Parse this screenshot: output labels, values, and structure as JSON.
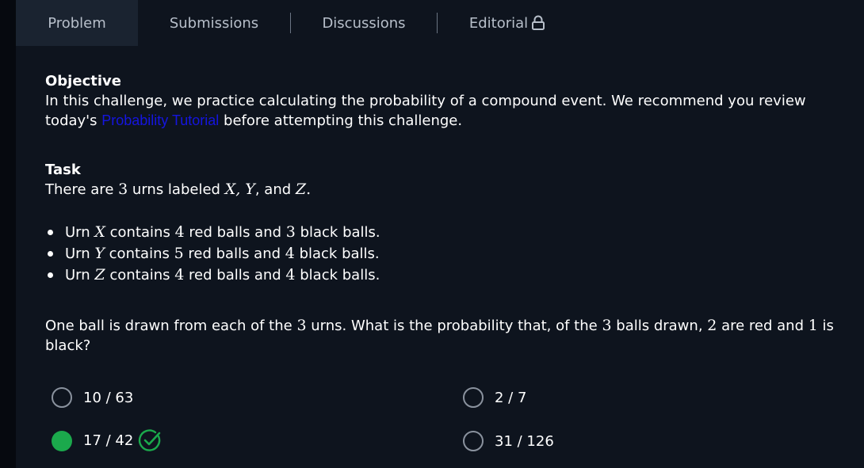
{
  "tabs": [
    {
      "label": "Problem"
    },
    {
      "label": "Submissions"
    },
    {
      "label": "Discussions"
    },
    {
      "label": "Editorial"
    }
  ],
  "objective": {
    "heading": "Objective",
    "text_before": "In this challenge, we practice calculating the probability of a compound event. We recommend you review today's ",
    "link": "Probability Tutorial",
    "text_after": " before attempting this challenge."
  },
  "task": {
    "heading": "Task",
    "intro": {
      "p1": "There are ",
      "n": "3",
      "p2": " urns labeled ",
      "labels": "X, Y",
      "p3": ", and ",
      "last": "Z",
      "p4": "."
    },
    "bullets": [
      {
        "pre": "Urn ",
        "urn": "X",
        "mid1": " contains ",
        "red": "4",
        "mid2": " red balls and ",
        "black": "3",
        "post": " black balls."
      },
      {
        "pre": "Urn ",
        "urn": "Y",
        "mid1": " contains ",
        "red": "5",
        "mid2": " red balls and ",
        "black": "4",
        "post": " black balls."
      },
      {
        "pre": "Urn ",
        "urn": "Z",
        "mid1": " contains ",
        "red": "4",
        "mid2": " red balls and ",
        "black": "4",
        "post": " black balls."
      }
    ]
  },
  "question": {
    "p1": "One ball is drawn from each of the ",
    "n1": "3",
    "p2": " urns. What is the probability that, of the ",
    "n2": "3",
    "p3": " balls drawn, ",
    "n3": "2",
    "p4": " are red and ",
    "n4": "1",
    "p5": " is black?"
  },
  "options": [
    {
      "label": "10 / 63",
      "selected": false
    },
    {
      "label": "2 / 7",
      "selected": false
    },
    {
      "label": "17 / 42",
      "selected": true,
      "correct": true
    },
    {
      "label": "31 / 126",
      "selected": false
    }
  ],
  "colors": {
    "background": "#0e141e",
    "active_tab": "#1a2330",
    "link": "#1515e0",
    "correct": "#1ba94c"
  },
  "icons": {
    "editorial": "lock-icon",
    "correct": "check-circle-icon"
  }
}
